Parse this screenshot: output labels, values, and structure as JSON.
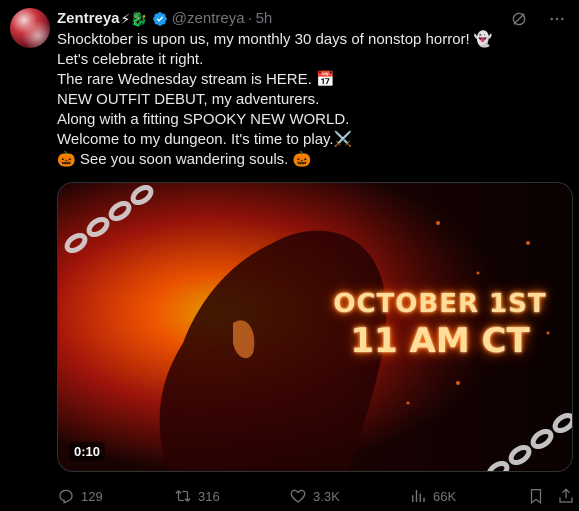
{
  "author": {
    "name": "Zentreya",
    "name_emojis": "⚡🐉",
    "handle": "@zentreya",
    "separator": "·",
    "time": "5h"
  },
  "tweet_lines": [
    "Shocktober is upon us, my monthly 30 days of nonstop horror! 👻",
    "Let's celebrate it right.",
    "The rare Wednesday stream is HERE. 📅",
    "NEW OUTFIT DEBUT, my adventurers.",
    "Along with a fitting SPOOKY NEW WORLD.",
    "Welcome to my dungeon. It's time to play.⚔️",
    "🎃 See you soon wandering souls. 🎃"
  ],
  "media": {
    "overlay_line1": "OCTOBER 1ST",
    "overlay_line2": "11 AM CT",
    "video_time": "0:10"
  },
  "actions": {
    "replies": "129",
    "retweets": "316",
    "likes": "3.3K",
    "views": "66K"
  },
  "icons": {
    "header": [
      "grok-icon",
      "more-icon"
    ],
    "actions": [
      "reply-icon",
      "retweet-icon",
      "like-icon",
      "views-icon",
      "bookmark-icon",
      "share-icon"
    ]
  },
  "colors": {
    "background": "#000000",
    "text": "#e7e9ea",
    "muted": "#71767b",
    "verified": "#1d9bf0"
  }
}
